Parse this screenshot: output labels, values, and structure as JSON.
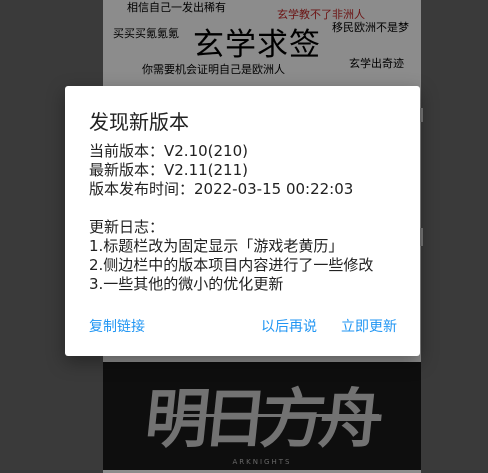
{
  "background": {
    "word_cloud": [
      {
        "text": "相信自己一发出稀有",
        "color": "#000000"
      },
      {
        "text": "玄学教不了非洲人",
        "color": "#c62828"
      },
      {
        "text": "买买买氪氪氪",
        "color": "#000000"
      },
      {
        "text": "移民欧洲不是梦",
        "color": "#000000"
      },
      {
        "text": "玄学求签",
        "color": "#000000"
      },
      {
        "text": "你需要机会证明自己是欧洲人",
        "color": "#000000"
      },
      {
        "text": "玄学出奇迹",
        "color": "#000000"
      }
    ],
    "banner_logo": "明日方舟",
    "banner_sub": "ARKNIGHTS"
  },
  "dialog": {
    "title": "发现新版本",
    "current_version": "当前版本：V2.10(210)",
    "latest_version": "最新版本：V2.11(211)",
    "release_time": "版本发布时间：2022-03-15 00:22:03",
    "changelog_title": "更新日志：",
    "changelog": [
      "1.标题栏改为固定显示「游戏老黄历」",
      "2.侧边栏中的版本项目内容进行了一些修改",
      "3.一些其他的微小的优化更新"
    ],
    "buttons": {
      "copy_link": "复制链接",
      "later": "以后再说",
      "update_now": "立即更新"
    },
    "accent": "#2196f3"
  }
}
